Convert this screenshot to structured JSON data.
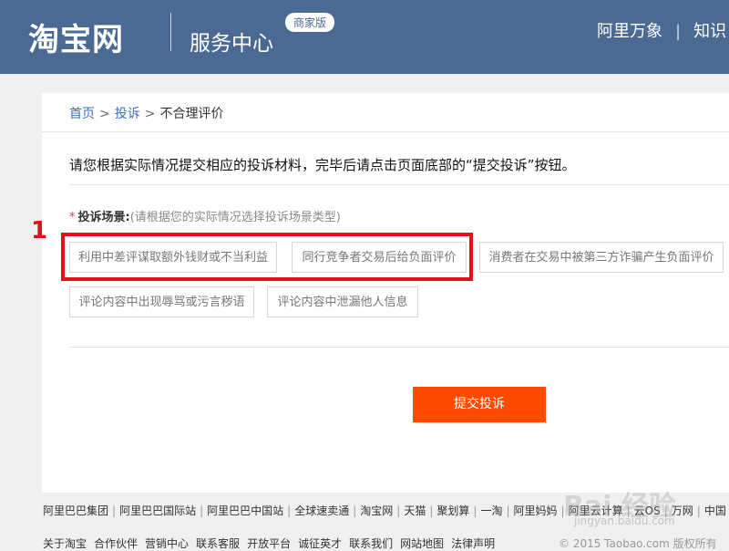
{
  "header": {
    "logo": "淘宝网",
    "title": "服务中心",
    "badge": "商家版",
    "nav": [
      "阿里万象",
      "知识"
    ]
  },
  "breadcrumb": {
    "home": "首页",
    "complaint": "投诉",
    "current": "不合理评价",
    "sep": ">"
  },
  "intro": "请您根据实际情况提交相应的投诉材料，完毕后请点击页面底部的“提交投诉”按钮。",
  "scene": {
    "required_mark": "*",
    "label": "投诉场景:",
    "hint": "(请根据您的实际情况选择投诉场景类型)",
    "options": [
      "利用中差评谋取额外钱财或不当利益",
      "同行竞争者交易后给负面评价",
      "消费者在交易中被第三方诈骗产生负面评价",
      "评论内容中出现辱骂或污言秽语",
      "评论内容中泄漏他人信息"
    ]
  },
  "submit_label": "提交投诉",
  "annotation": {
    "number": "1",
    "color": "#e31218"
  },
  "footer": {
    "links1": [
      "阿里巴巴集团",
      "阿里巴巴国际站",
      "阿里巴巴中国站",
      "全球速卖通",
      "淘宝网",
      "天猫",
      "聚划算",
      "一淘",
      "阿里妈妈",
      "阿里云计算",
      "云OS",
      "万网",
      "中国"
    ],
    "links2": [
      "关于淘宝",
      "合作伙伴",
      "营销中心",
      "联系客服",
      "开放平台",
      "诚征英才",
      "联系我们",
      "网站地图",
      "法律声明"
    ],
    "copyright": "© 2015 Taobao.com 版权所有"
  },
  "watermark": {
    "text": "Bai 经验",
    "sub": "jingyan.baidu.com"
  },
  "colors": {
    "header_bg": "#4b6a93",
    "submit_bg": "#ff4a00",
    "link": "#3a6fb4"
  }
}
